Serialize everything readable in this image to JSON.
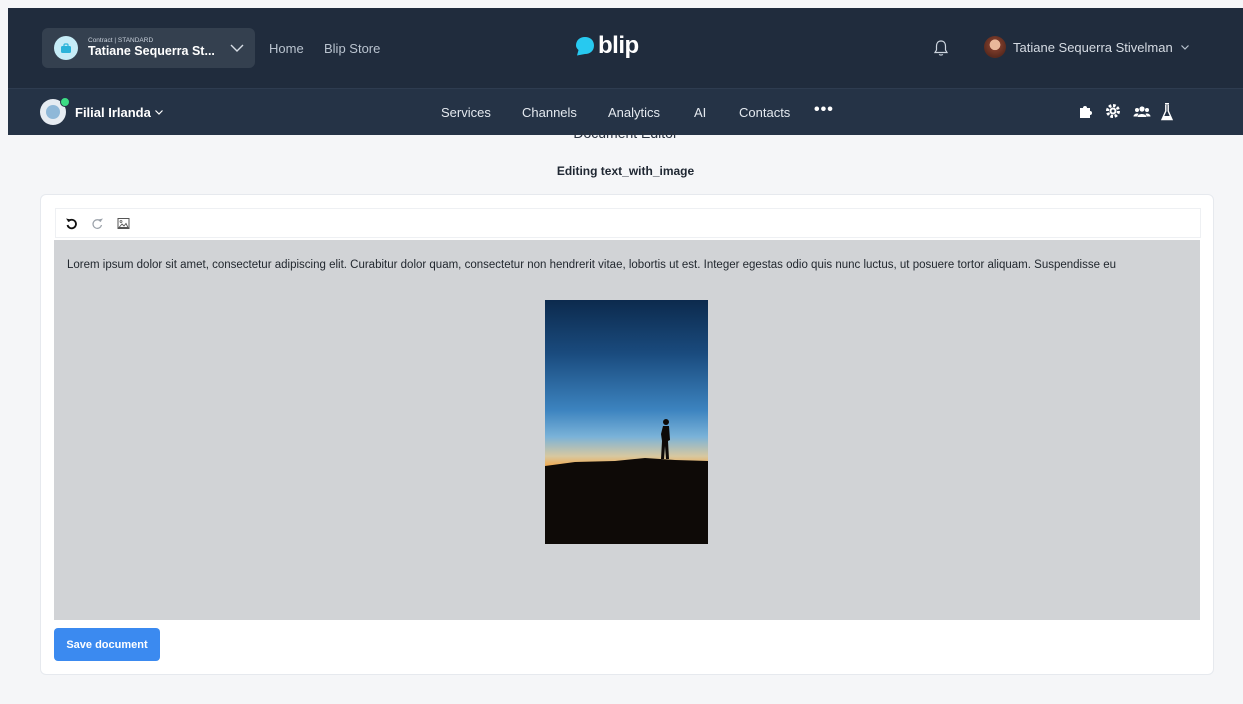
{
  "header": {
    "contract_label": "Contract | STANDARD",
    "contract_name": "Tatiane Sequerra St...",
    "links": [
      "Home",
      "Blip Store"
    ],
    "logo_text": "blip",
    "user_name": "Tatiane Sequerra Stivelman",
    "icons": [
      "bell-icon",
      "chevron-down-icon"
    ]
  },
  "subnav": {
    "bot_name": "Filial Irlanda",
    "items": [
      "Services",
      "Channels",
      "Analytics",
      "AI",
      "Contacts"
    ],
    "more": "•••",
    "tools": [
      "puzzle-icon",
      "gear-icon",
      "users-icon",
      "flask-icon"
    ]
  },
  "page": {
    "title": "Document Editor",
    "subtitle": "Editing text_with_image"
  },
  "editor": {
    "toolbar": [
      "undo-icon",
      "redo-icon",
      "image-icon"
    ],
    "text": "Lorem ipsum dolor sit amet, consectetur adipiscing elit. Curabitur dolor quam, consectetur non hendrerit vitae, lobortis ut est. Integer egestas odio quis nunc luctus, ut posuere tortor aliquam. Suspendisse eu",
    "image": "silhouette-at-sunset-photo"
  },
  "actions": {
    "save_label": "Save document"
  },
  "colors": {
    "topbar": "#202c3d",
    "subbar": "#253346",
    "accent": "#3b8af0",
    "logo": "#27c9f0",
    "online": "#3ddc84"
  }
}
